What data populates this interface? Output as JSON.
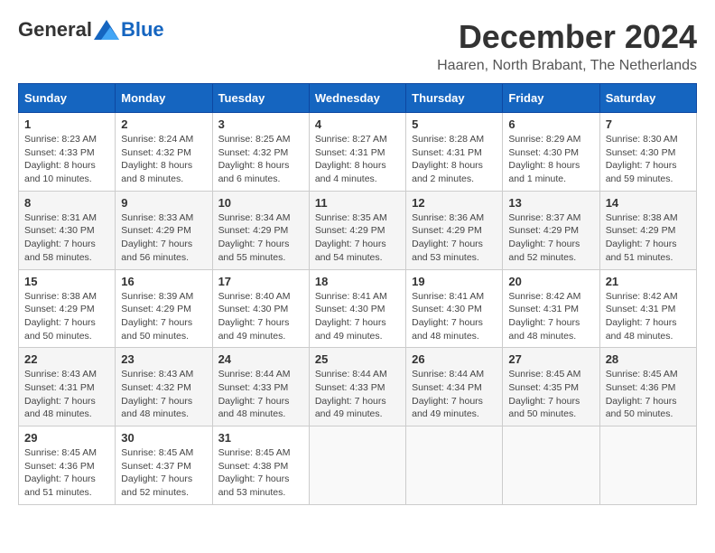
{
  "logo": {
    "general": "General",
    "blue": "Blue"
  },
  "title": "December 2024",
  "location": "Haaren, North Brabant, The Netherlands",
  "days_of_week": [
    "Sunday",
    "Monday",
    "Tuesday",
    "Wednesday",
    "Thursday",
    "Friday",
    "Saturday"
  ],
  "weeks": [
    [
      {
        "day": "1",
        "sunrise": "8:23 AM",
        "sunset": "4:33 PM",
        "daylight": "8 hours and 10 minutes."
      },
      {
        "day": "2",
        "sunrise": "8:24 AM",
        "sunset": "4:32 PM",
        "daylight": "8 hours and 8 minutes."
      },
      {
        "day": "3",
        "sunrise": "8:25 AM",
        "sunset": "4:32 PM",
        "daylight": "8 hours and 6 minutes."
      },
      {
        "day": "4",
        "sunrise": "8:27 AM",
        "sunset": "4:31 PM",
        "daylight": "8 hours and 4 minutes."
      },
      {
        "day": "5",
        "sunrise": "8:28 AM",
        "sunset": "4:31 PM",
        "daylight": "8 hours and 2 minutes."
      },
      {
        "day": "6",
        "sunrise": "8:29 AM",
        "sunset": "4:30 PM",
        "daylight": "8 hours and 1 minute."
      },
      {
        "day": "7",
        "sunrise": "8:30 AM",
        "sunset": "4:30 PM",
        "daylight": "7 hours and 59 minutes."
      }
    ],
    [
      {
        "day": "8",
        "sunrise": "8:31 AM",
        "sunset": "4:30 PM",
        "daylight": "7 hours and 58 minutes."
      },
      {
        "day": "9",
        "sunrise": "8:33 AM",
        "sunset": "4:29 PM",
        "daylight": "7 hours and 56 minutes."
      },
      {
        "day": "10",
        "sunrise": "8:34 AM",
        "sunset": "4:29 PM",
        "daylight": "7 hours and 55 minutes."
      },
      {
        "day": "11",
        "sunrise": "8:35 AM",
        "sunset": "4:29 PM",
        "daylight": "7 hours and 54 minutes."
      },
      {
        "day": "12",
        "sunrise": "8:36 AM",
        "sunset": "4:29 PM",
        "daylight": "7 hours and 53 minutes."
      },
      {
        "day": "13",
        "sunrise": "8:37 AM",
        "sunset": "4:29 PM",
        "daylight": "7 hours and 52 minutes."
      },
      {
        "day": "14",
        "sunrise": "8:38 AM",
        "sunset": "4:29 PM",
        "daylight": "7 hours and 51 minutes."
      }
    ],
    [
      {
        "day": "15",
        "sunrise": "8:38 AM",
        "sunset": "4:29 PM",
        "daylight": "7 hours and 50 minutes."
      },
      {
        "day": "16",
        "sunrise": "8:39 AM",
        "sunset": "4:29 PM",
        "daylight": "7 hours and 50 minutes."
      },
      {
        "day": "17",
        "sunrise": "8:40 AM",
        "sunset": "4:30 PM",
        "daylight": "7 hours and 49 minutes."
      },
      {
        "day": "18",
        "sunrise": "8:41 AM",
        "sunset": "4:30 PM",
        "daylight": "7 hours and 49 minutes."
      },
      {
        "day": "19",
        "sunrise": "8:41 AM",
        "sunset": "4:30 PM",
        "daylight": "7 hours and 48 minutes."
      },
      {
        "day": "20",
        "sunrise": "8:42 AM",
        "sunset": "4:31 PM",
        "daylight": "7 hours and 48 minutes."
      },
      {
        "day": "21",
        "sunrise": "8:42 AM",
        "sunset": "4:31 PM",
        "daylight": "7 hours and 48 minutes."
      }
    ],
    [
      {
        "day": "22",
        "sunrise": "8:43 AM",
        "sunset": "4:31 PM",
        "daylight": "7 hours and 48 minutes."
      },
      {
        "day": "23",
        "sunrise": "8:43 AM",
        "sunset": "4:32 PM",
        "daylight": "7 hours and 48 minutes."
      },
      {
        "day": "24",
        "sunrise": "8:44 AM",
        "sunset": "4:33 PM",
        "daylight": "7 hours and 48 minutes."
      },
      {
        "day": "25",
        "sunrise": "8:44 AM",
        "sunset": "4:33 PM",
        "daylight": "7 hours and 49 minutes."
      },
      {
        "day": "26",
        "sunrise": "8:44 AM",
        "sunset": "4:34 PM",
        "daylight": "7 hours and 49 minutes."
      },
      {
        "day": "27",
        "sunrise": "8:45 AM",
        "sunset": "4:35 PM",
        "daylight": "7 hours and 50 minutes."
      },
      {
        "day": "28",
        "sunrise": "8:45 AM",
        "sunset": "4:36 PM",
        "daylight": "7 hours and 50 minutes."
      }
    ],
    [
      {
        "day": "29",
        "sunrise": "8:45 AM",
        "sunset": "4:36 PM",
        "daylight": "7 hours and 51 minutes."
      },
      {
        "day": "30",
        "sunrise": "8:45 AM",
        "sunset": "4:37 PM",
        "daylight": "7 hours and 52 minutes."
      },
      {
        "day": "31",
        "sunrise": "8:45 AM",
        "sunset": "4:38 PM",
        "daylight": "7 hours and 53 minutes."
      },
      null,
      null,
      null,
      null
    ]
  ]
}
